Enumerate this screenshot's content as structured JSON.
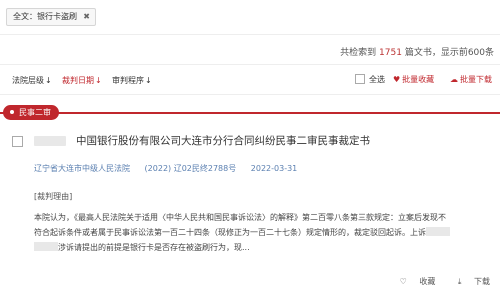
{
  "filter": {
    "chip_label": "全文：银行卡盗刷",
    "close_glyph": "✖"
  },
  "result": {
    "prefix": "共检索到 ",
    "count": "1751",
    "suffix": " 篇文书，显示前600条"
  },
  "sort": {
    "items": [
      {
        "label": "法院层级",
        "arrow": "↓",
        "active": false
      },
      {
        "label": "裁判日期",
        "arrow": "↓",
        "active": true
      },
      {
        "label": "审判程序",
        "arrow": "↓",
        "active": false
      }
    ]
  },
  "toolbar": {
    "select_all": "全选",
    "batch_collect": "批量收藏",
    "batch_download": "批量下载",
    "collect_icon": "heart-icon",
    "download_icon": "cloud-download-icon"
  },
  "case": {
    "type_tag": "民事二审",
    "title": "中国银行股份有限公司大连市分行合同纠纷民事二审民事裁定书",
    "court": "辽宁省大连市中级人民法院",
    "case_no": "(2022) 辽02民终2788号",
    "date": "2022-03-31",
    "reason_label": "[裁判理由]",
    "body_line1": "本院认为，《最高人民法院关于适用〈中华人民共和国民事诉讼法〉的解释》第二百零八条第三款规定：立案后发现不",
    "body_line2": "符合起诉条件或者属于民事诉讼法第一百二十四条（现修正为一百二十七条）规定情形的，裁定驳回起诉。上诉",
    "body_line3": "涉诉请提出的前提是银行卡是否存在被盗刷行为，现...",
    "collect": "收藏",
    "download": "下载"
  },
  "colors": {
    "accent": "#c0272d",
    "meta": "#5a7fb0"
  }
}
